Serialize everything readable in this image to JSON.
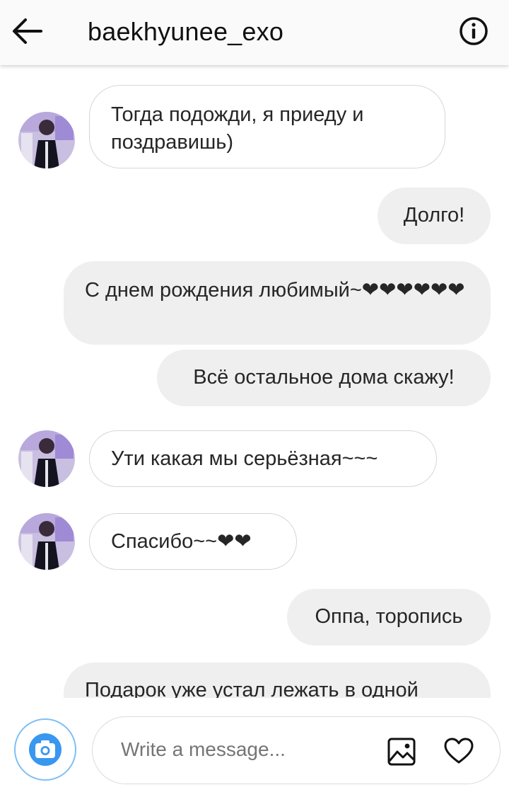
{
  "header": {
    "title": "baekhyunee_exo",
    "back_icon": "arrow-left-icon",
    "info_icon": "info-circle-icon"
  },
  "messages": [
    {
      "side": "incoming",
      "text": "Тогда подожди, я приеду и поздравишь)"
    },
    {
      "side": "outgoing",
      "text": "Долго!"
    },
    {
      "side": "outgoing",
      "text": "С днем рождения любимый~❤❤❤❤❤❤"
    },
    {
      "side": "outgoing",
      "text": "Всё остальное дома скажу!"
    },
    {
      "side": "incoming",
      "text": "Ути какая мы серьёзная~~~"
    },
    {
      "side": "incoming",
      "text": "Спасибо~~❤❤"
    },
    {
      "side": "outgoing",
      "text": "Оппа, торопись"
    },
    {
      "side": "outgoing",
      "text": "Подарок уже устал лежать в одной"
    }
  ],
  "composer": {
    "placeholder": "Write a message...",
    "camera_icon": "camera-icon",
    "gallery_icon": "image-icon",
    "like_icon": "heart-icon"
  },
  "colors": {
    "header_bg": "#fafafa",
    "outgoing_bubble": "#efefef",
    "incoming_border": "#d6d6d6",
    "accent": "#3897f0"
  }
}
